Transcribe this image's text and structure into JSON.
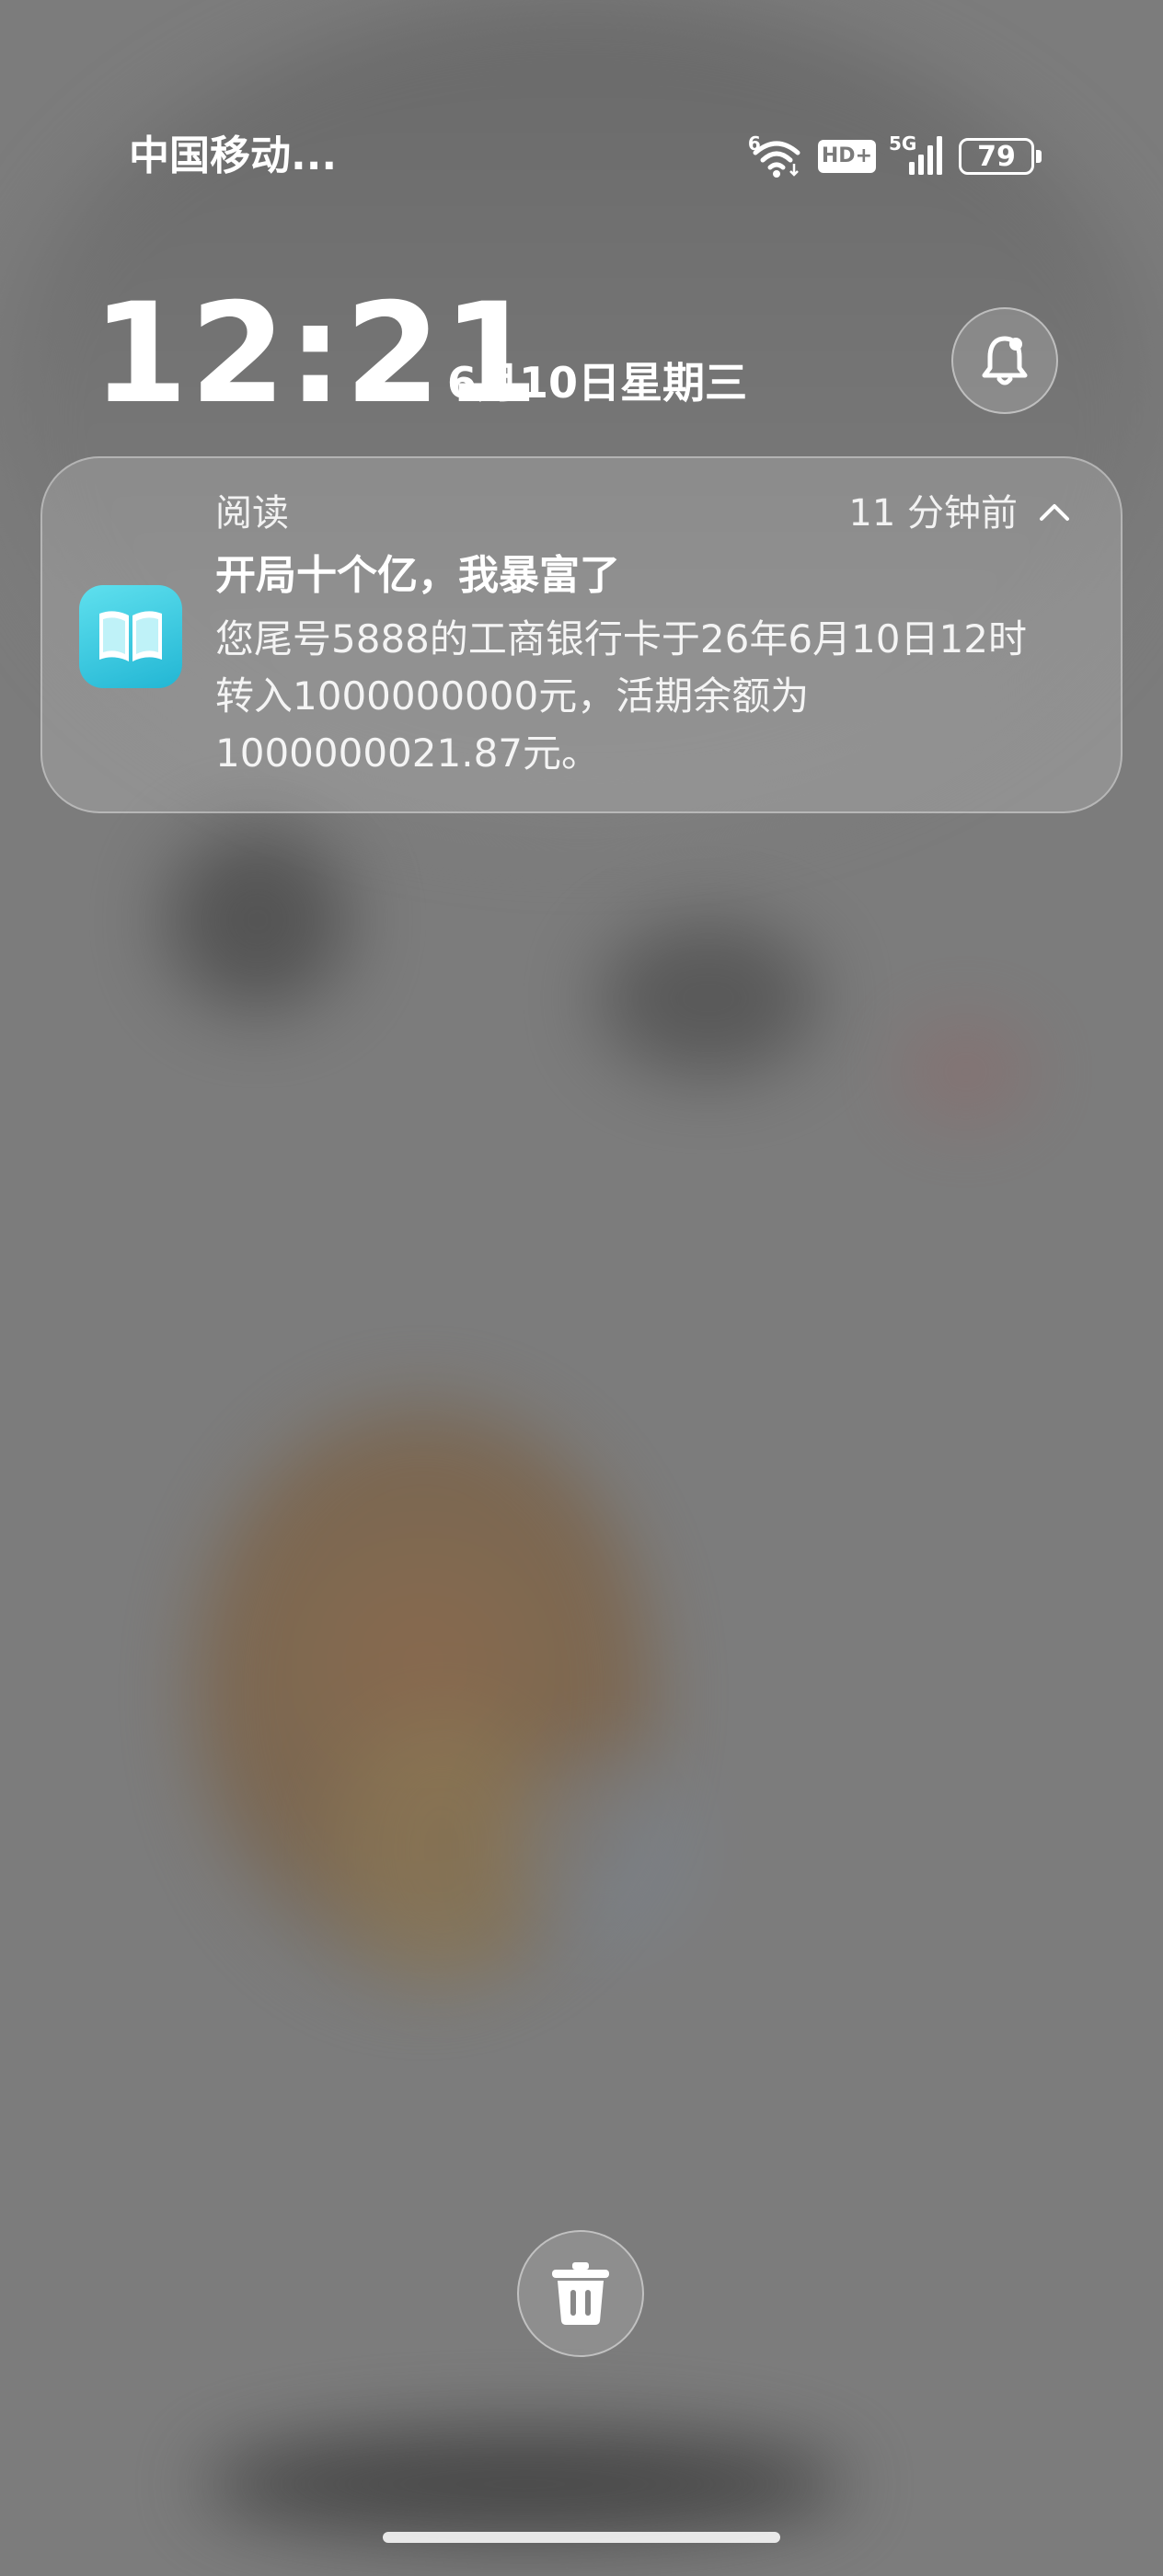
{
  "status_bar": {
    "carrier": "中国移动...",
    "wifi_tag": "6",
    "hd_label": "HD+",
    "network": "5G",
    "battery": "79"
  },
  "lockscreen": {
    "time": "12:21",
    "date": "6月10日星期三"
  },
  "notification": {
    "app_name": "阅读",
    "time_ago": "11 分钟前",
    "title": "开局十个亿，我暴富了",
    "body": "您尾号5888的工商银行卡于26年6月10日12时转入1000000000元，活期余额为1000000021.87元。",
    "app_icon": "book-icon",
    "accent": "#33c4df"
  },
  "actions": {
    "clear_icon": "trash-icon"
  }
}
